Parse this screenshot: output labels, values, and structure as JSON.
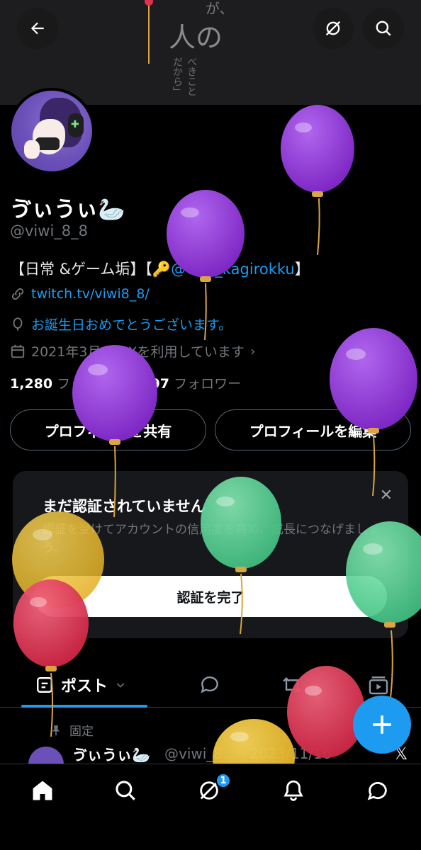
{
  "banner": {
    "text_line1": "が、",
    "text_line2": "人の",
    "text_line3": "べきことだから」"
  },
  "header": {
    "back_icon": "arrow-left-icon",
    "hide_icon": "eye-off-icon",
    "search_icon": "search-icon"
  },
  "profile": {
    "display_name": "ゔぃうぃ🦢",
    "handle": "@viwi_8_8",
    "bio_prefix": "【日常 &ゲーム垢】【🔑",
    "bio_mention": "@viwi_kagirokku",
    "bio_suffix": "】",
    "website": "twitch.tv/viwi8_8/",
    "birthday": "お誕生日おめでとうございます。",
    "joined": "2021年3月からXを利用しています",
    "following_count": "1,280",
    "following_label": "フォロー中",
    "followers_count": "197",
    "followers_label": "フォロワー"
  },
  "actions": {
    "share_label": "プロフィールを共有",
    "edit_label": "プロフィールを編集"
  },
  "verify_card": {
    "title": "まだ認証されていません",
    "description": "認証を受けてアカウントの信用度を高め、成長につなげましょう。",
    "button_label": "認証を完了",
    "close_symbol": "✕"
  },
  "tabs": {
    "posts_label": "ポスト"
  },
  "pinned_post": {
    "pinned_label": "固定",
    "author_name": "ゔぃうぃ🦢",
    "meta": "@viwi_8... · 2023/11/16"
  },
  "bottom_nav": {
    "notification_badge": "1"
  },
  "colors": {
    "accent": "#1d9bf0",
    "background": "#000000",
    "card_bg": "#16181c",
    "balloon_purple": "#8a33cf",
    "balloon_green": "#4fd18f",
    "balloon_yellow": "#f2c230",
    "balloon_red": "#e0314f"
  }
}
